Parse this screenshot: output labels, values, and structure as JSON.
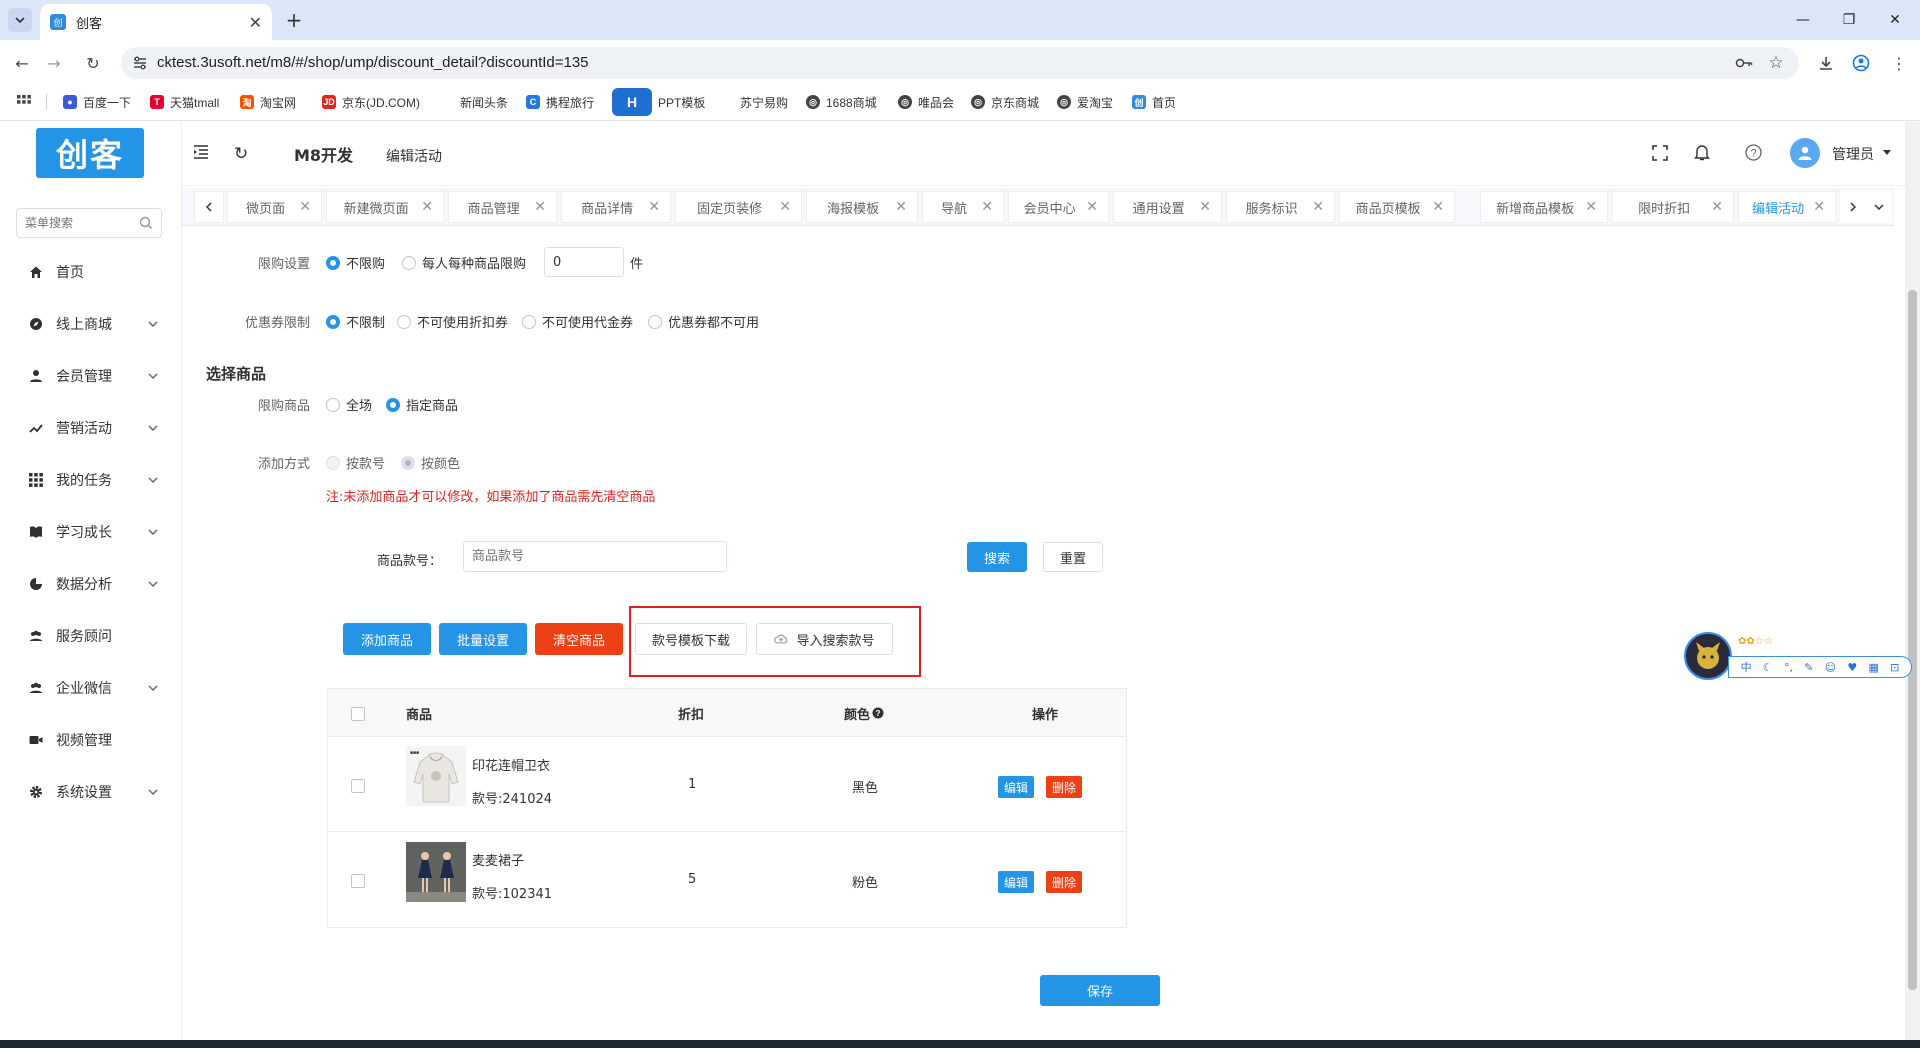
{
  "browser": {
    "tab_title": "创客",
    "url": "cktest.3usoft.net/m8/#/shop/ump/discount_detail?discountId=135",
    "bookmarks": [
      "百度一下",
      "天猫tmall",
      "淘宝网",
      "京东(JD.COM)",
      "新闻头条",
      "携程旅行",
      "PPT模板",
      "苏宁易购",
      "1688商城",
      "唯品会",
      "京东商城",
      "爱淘宝",
      "首页"
    ]
  },
  "app": {
    "logo": "创客",
    "title": "M8开发",
    "breadcrumb": "编辑活动",
    "user": "管理员",
    "menu_search_placeholder": "菜单搜索",
    "menu": [
      "首页",
      "线上商城",
      "会员管理",
      "营销活动",
      "我的任务",
      "学习成长",
      "数据分析",
      "服务顾问",
      "企业微信",
      "视频管理",
      "系统设置"
    ],
    "tags": [
      "微页面",
      "新建微页面",
      "商品管理",
      "商品详情",
      "固定页装修",
      "海报模板",
      "导航",
      "会员中心",
      "通用设置",
      "服务标识",
      "商品页模板",
      "新增商品模板",
      "限时折扣",
      "编辑活动"
    ]
  },
  "form": {
    "limit_label": "限购设置",
    "limit_opt1": "不限购",
    "limit_opt2": "每人每种商品限购",
    "limit_value": "0",
    "limit_unit": "件",
    "coupon_label": "优惠券限制",
    "coupon_opts": [
      "不限制",
      "不可使用折扣券",
      "不可使用代金券",
      "优惠券都不可用"
    ],
    "section_title": "选择商品",
    "goods_label": "限购商品",
    "goods_opts": [
      "全场",
      "指定商品"
    ],
    "add_mode_label": "添加方式",
    "add_mode_opts": [
      "按款号",
      "按颜色"
    ],
    "note": "注:未添加商品才可以修改，如果添加了商品需先清空商品",
    "sku_label": "商品款号：",
    "sku_placeholder": "商品款号",
    "search_btn": "搜索",
    "reset_btn": "重置",
    "add_goods_btn": "添加商品",
    "batch_btn": "批量设置",
    "clear_btn": "清空商品",
    "template_btn": "款号模板下载",
    "import_btn": "导入搜索款号",
    "save_btn": "保存"
  },
  "table": {
    "headers": [
      "商品",
      "折扣",
      "颜色",
      "操作"
    ],
    "edit": "编辑",
    "delete": "删除",
    "rows": [
      {
        "name": "印花连帽卫衣",
        "sku": "款号:241024",
        "discount": "1",
        "color": "黑色"
      },
      {
        "name": "麦麦裙子",
        "sku": "款号:102341",
        "discount": "5",
        "color": "粉色"
      }
    ]
  },
  "colors": {
    "primary": "#2394e6",
    "danger": "#ed4014",
    "highlight_box": "#e02020"
  }
}
